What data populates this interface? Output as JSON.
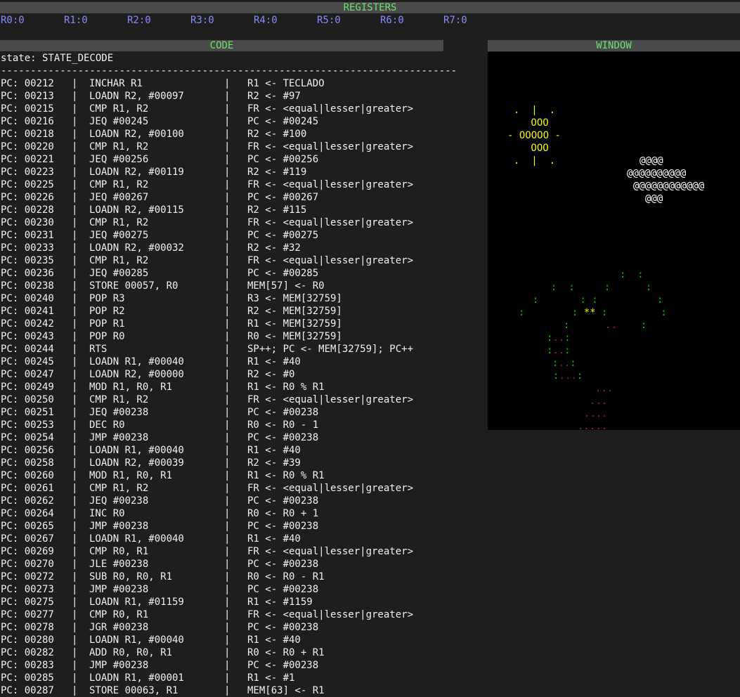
{
  "registers": {
    "title": "REGISTERS",
    "items": [
      "R0:0",
      "R1:0",
      "R2:0",
      "R3:0",
      "R4:0",
      "R5:0",
      "R6:0",
      "R7:0"
    ]
  },
  "code": {
    "title": "CODE",
    "state": "state: STATE_DECODE",
    "separator": "-----------------------------------------------------------------------------",
    "rows": [
      {
        "pc": "PC: 00212",
        "ins": "INCHAR R1",
        "eff": "R1 <- TECLADO"
      },
      {
        "pc": "PC: 00213",
        "ins": "LOADN R2, #00097",
        "eff": "R2 <- #97"
      },
      {
        "pc": "PC: 00215",
        "ins": "CMP R1, R2",
        "eff": "FR <- <equal|lesser|greater>"
      },
      {
        "pc": "PC: 00216",
        "ins": "JEQ #00245",
        "eff": "PC <- #00245"
      },
      {
        "pc": "PC: 00218",
        "ins": "LOADN R2, #00100",
        "eff": "R2 <- #100"
      },
      {
        "pc": "PC: 00220",
        "ins": "CMP R1, R2",
        "eff": "FR <- <equal|lesser|greater>"
      },
      {
        "pc": "PC: 00221",
        "ins": "JEQ #00256",
        "eff": "PC <- #00256"
      },
      {
        "pc": "PC: 00223",
        "ins": "LOADN R2, #00119",
        "eff": "R2 <- #119"
      },
      {
        "pc": "PC: 00225",
        "ins": "CMP R1, R2",
        "eff": "FR <- <equal|lesser|greater>"
      },
      {
        "pc": "PC: 00226",
        "ins": "JEQ #00267",
        "eff": "PC <- #00267"
      },
      {
        "pc": "PC: 00228",
        "ins": "LOADN R2, #00115",
        "eff": "R2 <- #115"
      },
      {
        "pc": "PC: 00230",
        "ins": "CMP R1, R2",
        "eff": "FR <- <equal|lesser|greater>"
      },
      {
        "pc": "PC: 00231",
        "ins": "JEQ #00275",
        "eff": "PC <- #00275"
      },
      {
        "pc": "PC: 00233",
        "ins": "LOADN R2, #00032",
        "eff": "R2 <- #32"
      },
      {
        "pc": "PC: 00235",
        "ins": "CMP R1, R2",
        "eff": "FR <- <equal|lesser|greater>"
      },
      {
        "pc": "PC: 00236",
        "ins": "JEQ #00285",
        "eff": "PC <- #00285"
      },
      {
        "pc": "PC: 00238",
        "ins": "STORE 00057, R0",
        "eff": "MEM[57] <- R0"
      },
      {
        "pc": "PC: 00240",
        "ins": "POP R3",
        "eff": "R3 <- MEM[32759]"
      },
      {
        "pc": "PC: 00241",
        "ins": "POP R2",
        "eff": "R2 <- MEM[32759]"
      },
      {
        "pc": "PC: 00242",
        "ins": "POP R1",
        "eff": "R1 <- MEM[32759]"
      },
      {
        "pc": "PC: 00243",
        "ins": "POP R0",
        "eff": "R0 <- MEM[32759]"
      },
      {
        "pc": "PC: 00244",
        "ins": "RTS",
        "eff": "SP++; PC <- MEM[32759]; PC++"
      },
      {
        "pc": "PC: 00245",
        "ins": "LOADN R1, #00040",
        "eff": "R1 <- #40"
      },
      {
        "pc": "PC: 00247",
        "ins": "LOADN R2, #00000",
        "eff": "R2 <- #0"
      },
      {
        "pc": "PC: 00249",
        "ins": "MOD R1, R0, R1",
        "eff": "R1 <- R0 % R1"
      },
      {
        "pc": "PC: 00250",
        "ins": "CMP R1, R2",
        "eff": "FR <- <equal|lesser|greater>"
      },
      {
        "pc": "PC: 00251",
        "ins": "JEQ #00238",
        "eff": "PC <- #00238"
      },
      {
        "pc": "PC: 00253",
        "ins": "DEC R0",
        "eff": "R0 <- R0 - 1"
      },
      {
        "pc": "PC: 00254",
        "ins": "JMP #00238",
        "eff": "PC <- #00238"
      },
      {
        "pc": "PC: 00256",
        "ins": "LOADN R1, #00040",
        "eff": "R1 <- #40"
      },
      {
        "pc": "PC: 00258",
        "ins": "LOADN R2, #00039",
        "eff": "R2 <- #39"
      },
      {
        "pc": "PC: 00260",
        "ins": "MOD R1, R0, R1",
        "eff": "R1 <- R0 % R1"
      },
      {
        "pc": "PC: 00261",
        "ins": "CMP R1, R2",
        "eff": "FR <- <equal|lesser|greater>"
      },
      {
        "pc": "PC: 00262",
        "ins": "JEQ #00238",
        "eff": "PC <- #00238"
      },
      {
        "pc": "PC: 00264",
        "ins": "INC R0",
        "eff": "R0 <- R0 + 1"
      },
      {
        "pc": "PC: 00265",
        "ins": "JMP #00238",
        "eff": "PC <- #00238"
      },
      {
        "pc": "PC: 00267",
        "ins": "LOADN R1, #00040",
        "eff": "R1 <- #40"
      },
      {
        "pc": "PC: 00269",
        "ins": "CMP R0, R1",
        "eff": "FR <- <equal|lesser|greater>"
      },
      {
        "pc": "PC: 00270",
        "ins": "JLE #00238",
        "eff": "PC <- #00238"
      },
      {
        "pc": "PC: 00272",
        "ins": "SUB R0, R0, R1",
        "eff": "R0 <- R0 - R1"
      },
      {
        "pc": "PC: 00273",
        "ins": "JMP #00238",
        "eff": "PC <- #00238"
      },
      {
        "pc": "PC: 00275",
        "ins": "LOADN R1, #01159",
        "eff": "R1 <- #1159"
      },
      {
        "pc": "PC: 00277",
        "ins": "CMP R0, R1",
        "eff": "FR <- <equal|lesser|greater>"
      },
      {
        "pc": "PC: 00278",
        "ins": "JGR #00238",
        "eff": "PC <- #00238"
      },
      {
        "pc": "PC: 00280",
        "ins": "LOADN R1, #00040",
        "eff": "R1 <- #40"
      },
      {
        "pc": "PC: 00282",
        "ins": "ADD R0, R0, R1",
        "eff": "R0 <- R0 + R1"
      },
      {
        "pc": "PC: 00283",
        "ins": "JMP #00238",
        "eff": "PC <- #00238"
      },
      {
        "pc": "PC: 00285",
        "ins": "LOADN R1, #00001",
        "eff": "R1 <- #1"
      },
      {
        "pc": "PC: 00287",
        "ins": "STORE 00063, R1",
        "eff": "MEM[63] <- R1"
      }
    ]
  },
  "window": {
    "title": "WINDOW",
    "colors": {
      "yellow": "#f5f500",
      "white": "#ffffff",
      "green": "#00d000",
      "red": "#a02020"
    },
    "sun": [
      ".  |  .",
      " OOO",
      "- OOOOO -",
      " OOO",
      ".  |  ."
    ],
    "cloud": [
      "@@@@",
      "@@@@@@@@@@",
      "@@@@@@@@@@@@",
      "@@@"
    ],
    "tree_segments": [
      [
        {
          "t": ":  :",
          "c": "green"
        }
      ],
      [
        {
          "t": ":  :     :      :",
          "c": "green"
        }
      ],
      [
        {
          "t": ":       : :          :",
          "c": "green"
        }
      ],
      [
        {
          "t": ":        : ",
          "c": "green"
        },
        {
          "t": "**",
          "c": "yellow"
        },
        {
          "t": " :         :",
          "c": "green"
        }
      ],
      [
        {
          "t": ":      ",
          "c": "green"
        },
        {
          "t": "..",
          "c": "red"
        },
        {
          "t": "    :",
          "c": "green"
        }
      ],
      [
        {
          "t": ":",
          "c": "green"
        },
        {
          "t": "..",
          "c": "red"
        },
        {
          "t": ":",
          "c": "green"
        }
      ],
      [
        {
          "t": ":",
          "c": "green"
        },
        {
          "t": "..",
          "c": "red"
        },
        {
          "t": ":",
          "c": "green"
        }
      ],
      [
        {
          "t": ":",
          "c": "green"
        },
        {
          "t": "..",
          "c": "red"
        },
        {
          "t": ":",
          "c": "green"
        }
      ],
      [
        {
          "t": ":",
          "c": "green"
        },
        {
          "t": "...",
          "c": "red"
        },
        {
          "t": ":",
          "c": "green"
        }
      ],
      [
        {
          "t": "...",
          "c": "red"
        }
      ],
      [
        {
          "t": "...",
          "c": "red"
        }
      ],
      [
        {
          "t": "....",
          "c": "red"
        }
      ],
      [
        {
          "t": ".....",
          "c": "red"
        }
      ]
    ]
  }
}
